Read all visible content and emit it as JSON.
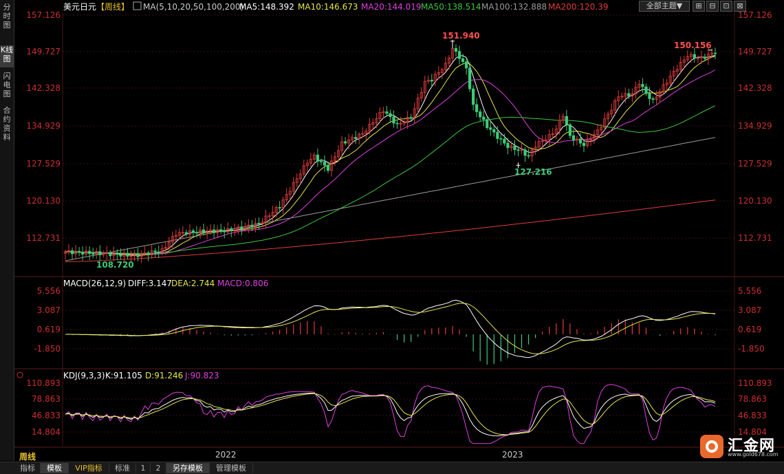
{
  "sidebar": {
    "tabs": [
      {
        "label": "分时图",
        "active": false
      },
      {
        "label": "K线图",
        "active": true
      },
      {
        "label": "闪电图",
        "active": false
      },
      {
        "label": "合约资料",
        "active": false
      }
    ]
  },
  "header": {
    "symbol": "美元日元",
    "period_tag": "【周线】",
    "ma_settings": "MA(5,10,20,50,100,200)",
    "ma_values": [
      {
        "label": "MA5:148.392",
        "color": "#ffffff"
      },
      {
        "label": "MA10:146.673",
        "color": "#e6e64c"
      },
      {
        "label": "MA20:144.019",
        "color": "#e040e0"
      },
      {
        "label": "MA50:138.514",
        "color": "#3cc83c"
      },
      {
        "label": "MA100:132.888",
        "color": "#9a9a9a"
      },
      {
        "label": "MA200:120.39",
        "color": "#e03c3c"
      }
    ]
  },
  "toolbar": {
    "theme_select": "全部主题▼",
    "buttons": [
      "⊞",
      "⊟",
      "⊡",
      "⊠"
    ]
  },
  "colors": {
    "up": "#e03c3c",
    "down": "#3ccc78",
    "grid": "#3a1010",
    "axis_label": "#cc2f2f"
  },
  "price_panel": {
    "ticks": [
      "157.126",
      "149.727",
      "142.328",
      "134.929",
      "127.529",
      "120.130",
      "112.731"
    ],
    "annotations": [
      {
        "label": "151.940",
        "color": "#ff5050"
      },
      {
        "label": "150.156",
        "color": "#ff5050"
      },
      {
        "label": "127.216",
        "color": "#3ccc78"
      },
      {
        "label": "108.720",
        "color": "#3ccc78"
      }
    ]
  },
  "macd_panel": {
    "title": "MACD(26,12,9)",
    "diff": "DIFF:3.147",
    "dea": "DEA:2.744",
    "macd": "MACD:0.806",
    "ticks": [
      "5.556",
      "3.087",
      "0.619",
      "-1.850"
    ]
  },
  "kdj_panel": {
    "title": "KDJ(9,3,3)",
    "k": "K:91.105",
    "d": "D:91.246",
    "j": "J:90.823",
    "ticks": [
      "110.893",
      "78.863",
      "46.833",
      "14.804"
    ]
  },
  "time_axis": {
    "labels": [
      "2022",
      "2023"
    ]
  },
  "period_label": "周线",
  "bottom_tabs": [
    {
      "label": "指标",
      "active": false,
      "vip": false
    },
    {
      "label": "模板",
      "active": true,
      "vip": false
    },
    {
      "label": "VIP指标",
      "active": false,
      "vip": true
    },
    {
      "label": "标准",
      "active": false,
      "vip": false
    },
    {
      "label": "1",
      "active": false,
      "vip": false
    },
    {
      "label": "2",
      "active": false,
      "vip": false
    },
    {
      "label": "另存模板",
      "active": true,
      "vip": false
    },
    {
      "label": "管理模板",
      "active": false,
      "vip": false
    }
  ],
  "watermark": {
    "name": "汇金网",
    "url": "www.gold678.com"
  },
  "chart_data": {
    "type": "candlestick",
    "panels": [
      {
        "name": "price",
        "ylim": [
          106.5,
          158.5
        ],
        "key_values": {
          "high": 151.94,
          "recent_high": 150.156,
          "low_2023": 127.216,
          "low_2021": 108.72
        },
        "ma": {
          "MA5": 148.392,
          "MA10": 146.673,
          "MA20": 144.019,
          "MA50": 138.514,
          "MA100": 132.888,
          "MA200": 120.39
        }
      },
      {
        "name": "MACD",
        "ylim": [
          -3.6,
          6.6
        ],
        "DIFF": 3.147,
        "DEA": 2.744,
        "MACD": 0.806
      },
      {
        "name": "KDJ",
        "ylim": [
          -5,
          120
        ],
        "K": 91.105,
        "D": 91.246,
        "J": 90.823
      }
    ],
    "x_labels": [
      "2022",
      "2023"
    ]
  }
}
